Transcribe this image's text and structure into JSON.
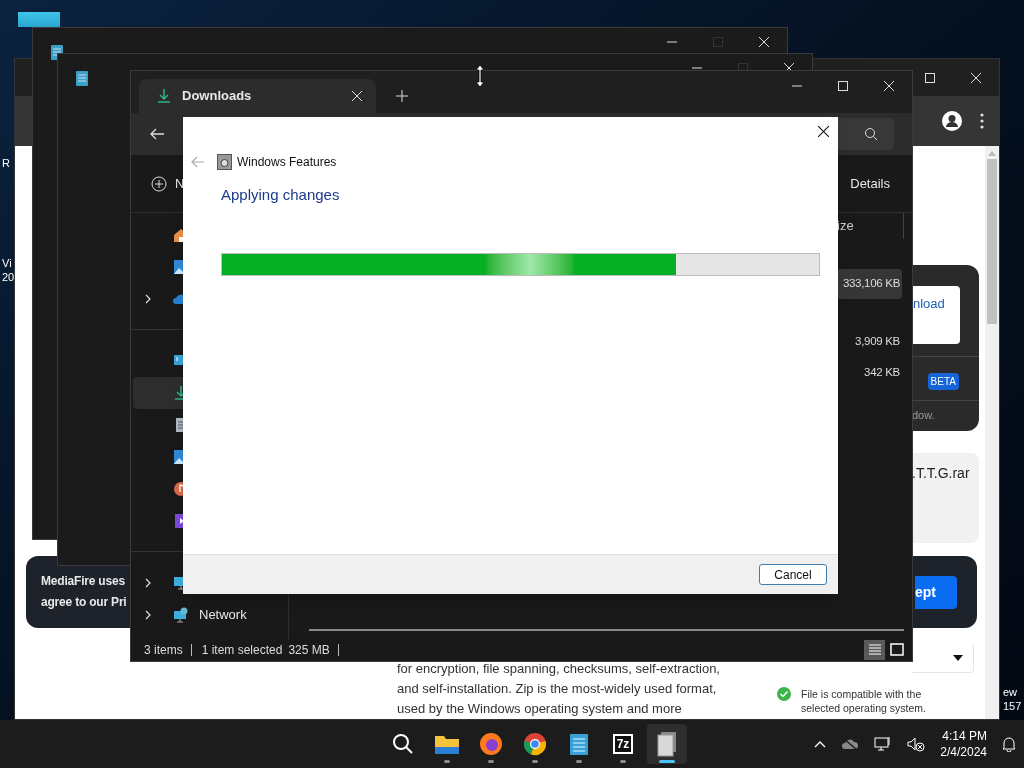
{
  "desktop": {
    "left_labels": [
      "R",
      "Vi",
      "20"
    ],
    "right_labels": [
      "ew",
      "157"
    ]
  },
  "browser": {
    "download_button": "nload",
    "badge": "BETA",
    "note": "dow.",
    "file_name": ".T.T.G.rar",
    "cookie_banner": {
      "lines": [
        "MediaFire uses",
        "agree to our Pri"
      ],
      "accept_button": "ept"
    },
    "compatibility": "File is compatible with the selected operating system.",
    "description": [
      "for encryption, file spanning, checksums, self-extraction,",
      "and self-installation. Zip is the most-widely used format,",
      "used by the Windows operating system and more"
    ]
  },
  "explorer": {
    "tab": {
      "label": "Downloads"
    },
    "new_button": "N",
    "details_button": "Details",
    "column": "ize",
    "files": [
      {
        "size": "333,106 KB",
        "selected": true
      },
      {
        "size": "3,909 KB",
        "selected": false
      },
      {
        "size": "342 KB",
        "selected": false
      }
    ],
    "nav": [
      [
        {
          "selected": false,
          "expandable": false
        },
        {
          "selected": false,
          "expandable": false
        },
        {
          "selected": false,
          "expandable": true
        }
      ],
      [
        {
          "selected": false,
          "expandable": false
        },
        {
          "selected": true,
          "expandable": false
        },
        {
          "selected": false,
          "expandable": false
        },
        {
          "selected": false,
          "expandable": false
        },
        {
          "selected": false,
          "expandable": false
        },
        {
          "selected": false,
          "expandable": false
        }
      ],
      [
        {
          "selected": false,
          "expandable": true
        },
        {
          "selected": false,
          "expandable": true,
          "label": "Network"
        }
      ]
    ],
    "status": {
      "count": "3 items",
      "selection": "1 item selected",
      "size": "325 MB"
    },
    "view_modes": [
      {
        "selected": true
      },
      {
        "selected": false
      }
    ]
  },
  "dialog": {
    "title": "Windows Features",
    "heading": "Applying changes",
    "progress": {
      "level": 0.76
    },
    "cancel": "Cancel"
  },
  "taskbar": {
    "apps": [
      {
        "running": false,
        "active": false
      },
      {
        "running": true,
        "active": false
      },
      {
        "running": true,
        "active": false
      },
      {
        "running": true,
        "active": false
      },
      {
        "running": true,
        "active": false
      },
      {
        "running": true,
        "active": false,
        "logo_text": "7z"
      },
      {
        "running": true,
        "active": true
      }
    ],
    "time": "4:14 PM",
    "date": "2/4/2024"
  }
}
